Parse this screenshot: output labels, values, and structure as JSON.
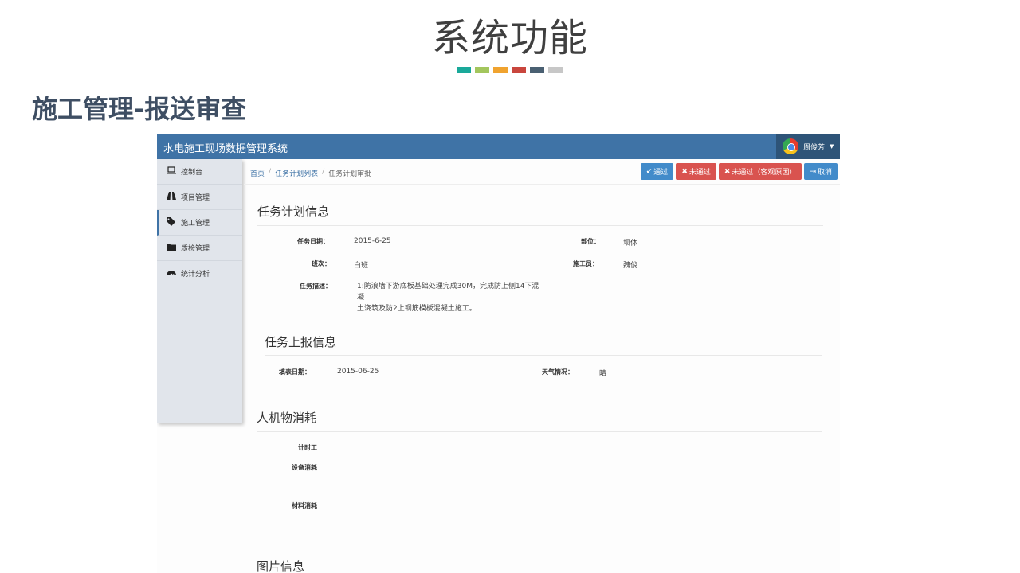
{
  "slide": {
    "title": "系统功能",
    "subtitle": "施工管理-报送审查",
    "swatches": [
      "#1aa99a",
      "#a3c65d",
      "#f0a32f",
      "#c9463d",
      "#4a6072",
      "#c7c7c7"
    ]
  },
  "app": {
    "title": "水电施工现场数据管理系统",
    "user_name": "周俊芳",
    "sidebar": [
      {
        "label": "控制台",
        "icon": "laptop-icon"
      },
      {
        "label": "项目管理",
        "icon": "road-icon"
      },
      {
        "label": "施工管理",
        "icon": "tags-icon"
      },
      {
        "label": "质检管理",
        "icon": "folder-icon"
      },
      {
        "label": "统计分析",
        "icon": "dashboard-icon"
      }
    ],
    "breadcrumb": [
      "首页",
      "任务计划列表",
      "任务计划审批"
    ],
    "actions": {
      "pass": "通过",
      "fail": "未通过",
      "fail_objective": "未通过（客观原因）",
      "cancel": "取消"
    },
    "plan": {
      "title": "任务计划信息",
      "date_label": "任务日期：",
      "date": "2015-6-25",
      "part_label": "部位：",
      "part": "坝体",
      "shift_label": "班次：",
      "shift": "白班",
      "worker_label": "施工员：",
      "worker": "魏俊",
      "desc_label": "任务描述：",
      "desc_line1": "1:防浪墙下游底板基础处理完成30M，完成防上侧14下混凝",
      "desc_line2": "土浇筑及防2上钢筋模板混凝土施工。"
    },
    "report": {
      "title": "任务上报信息",
      "date_label": "填表日期：",
      "date": "2015-06-25",
      "weather_label": "天气情况：",
      "weather": "晴"
    },
    "resources": {
      "title": "人机物消耗",
      "hourly": "计时工",
      "equipment": "设备消耗",
      "material": "材料消耗"
    },
    "images": {
      "title": "图片信息"
    }
  }
}
